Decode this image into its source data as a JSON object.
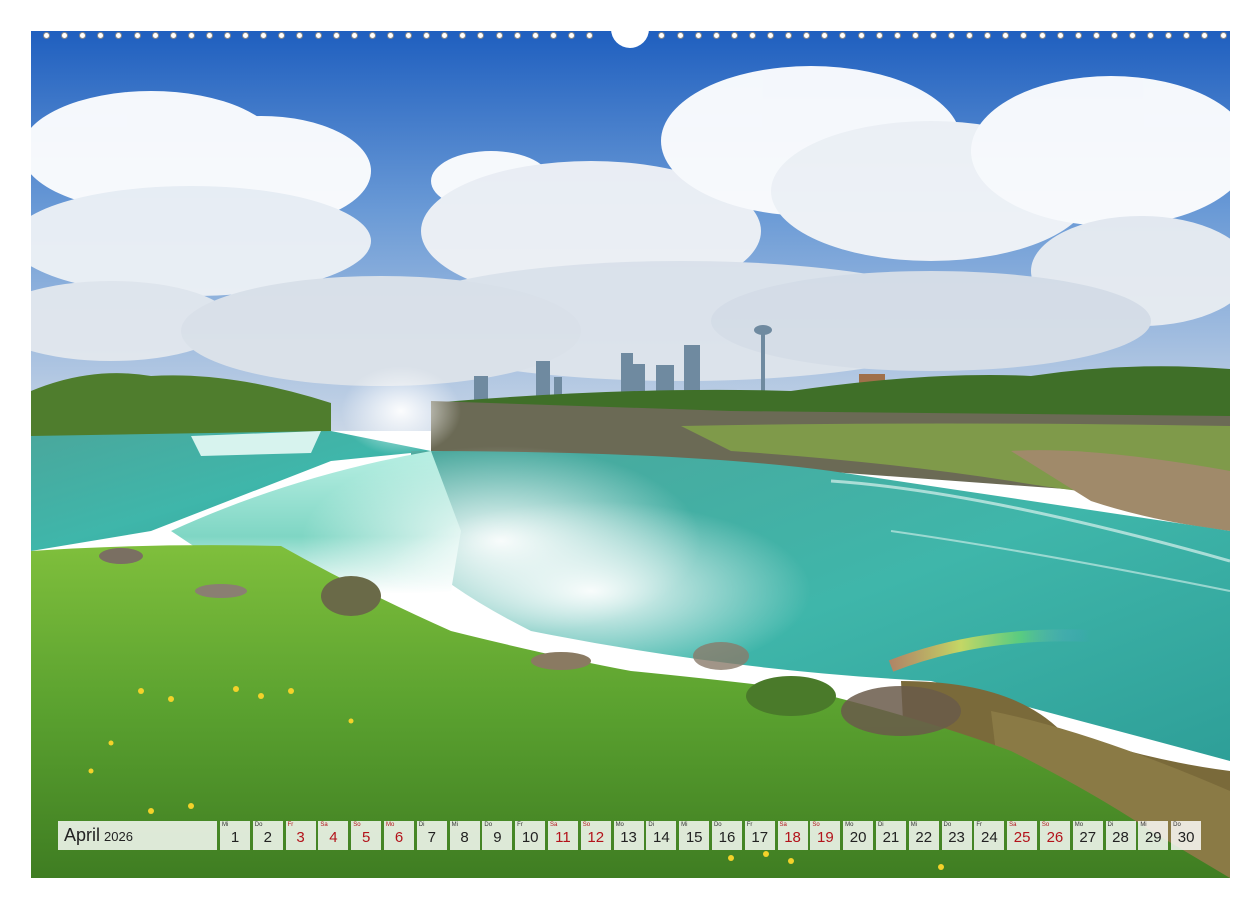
{
  "calendar": {
    "month": "April",
    "year": "2026",
    "days": [
      {
        "wd": "Mi",
        "n": "1",
        "red": false
      },
      {
        "wd": "Do",
        "n": "2",
        "red": false
      },
      {
        "wd": "Fr",
        "n": "3",
        "red": true
      },
      {
        "wd": "Sa",
        "n": "4",
        "red": true
      },
      {
        "wd": "So",
        "n": "5",
        "red": true
      },
      {
        "wd": "Mo",
        "n": "6",
        "red": true
      },
      {
        "wd": "Di",
        "n": "7",
        "red": false
      },
      {
        "wd": "Mi",
        "n": "8",
        "red": false
      },
      {
        "wd": "Do",
        "n": "9",
        "red": false
      },
      {
        "wd": "Fr",
        "n": "10",
        "red": false
      },
      {
        "wd": "Sa",
        "n": "11",
        "red": true
      },
      {
        "wd": "So",
        "n": "12",
        "red": true
      },
      {
        "wd": "Mo",
        "n": "13",
        "red": false
      },
      {
        "wd": "Di",
        "n": "14",
        "red": false
      },
      {
        "wd": "Mi",
        "n": "15",
        "red": false
      },
      {
        "wd": "Do",
        "n": "16",
        "red": false
      },
      {
        "wd": "Fr",
        "n": "17",
        "red": false
      },
      {
        "wd": "Sa",
        "n": "18",
        "red": true
      },
      {
        "wd": "So",
        "n": "19",
        "red": true
      },
      {
        "wd": "Mo",
        "n": "20",
        "red": false
      },
      {
        "wd": "Di",
        "n": "21",
        "red": false
      },
      {
        "wd": "Mi",
        "n": "22",
        "red": false
      },
      {
        "wd": "Do",
        "n": "23",
        "red": false
      },
      {
        "wd": "Fr",
        "n": "24",
        "red": false
      },
      {
        "wd": "Sa",
        "n": "25",
        "red": true
      },
      {
        "wd": "So",
        "n": "26",
        "red": true
      },
      {
        "wd": "Mo",
        "n": "27",
        "red": false
      },
      {
        "wd": "Di",
        "n": "28",
        "red": false
      },
      {
        "wd": "Mi",
        "n": "29",
        "red": false
      },
      {
        "wd": "Do",
        "n": "30",
        "red": false
      }
    ]
  },
  "colors": {
    "accent_red": "#b3121a",
    "sky": "#2f6fc4",
    "water": "#3fb3a8",
    "grass": "#5aa12f"
  }
}
